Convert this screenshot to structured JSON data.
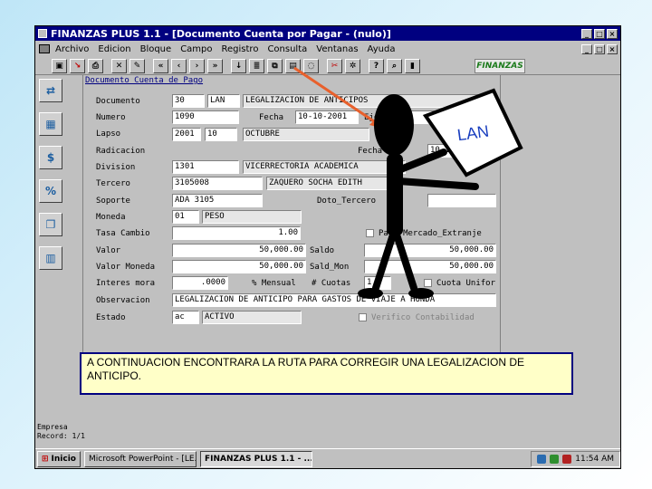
{
  "window": {
    "title": "FINANZAS PLUS 1.1 - [Documento Cuenta por Pagar - (nulo)]",
    "buttons": [
      "_",
      "□",
      "×"
    ]
  },
  "menu": {
    "items": [
      "Archivo",
      "Edicion",
      "Bloque",
      "Campo",
      "Registro",
      "Consulta",
      "Ventanas",
      "Ayuda"
    ],
    "mdi_buttons": [
      "_",
      "□",
      "×"
    ]
  },
  "toolbar": {
    "buttons": [
      "save",
      "exit",
      "print",
      "clear",
      "edit",
      "first",
      "prev",
      "next",
      "last",
      "insert",
      "list",
      "copy",
      "paste",
      "delete",
      "help",
      "query",
      "stop"
    ],
    "logo": "FINANZAS"
  },
  "form": {
    "title": "Documento Cuenta de Pago",
    "labels": {
      "documento": "Documento",
      "numero": "Numero",
      "lapso": "Lapso",
      "radicacion": "Radicacion",
      "division": "Division",
      "tercero": "Tercero",
      "soporte": "Soporte",
      "moneda": "Moneda",
      "tasa_cambio": "Tasa Cambio",
      "valor": "Valor",
      "valor_moneda": "Valor Moneda",
      "interes_mora": "Interes mora",
      "observacion": "Observacion",
      "estado": "Estado",
      "fecha": "Fecha",
      "ejec": "Ejec",
      "fecha2": "Fecha",
      "doto_tercero": "Doto_Tercero",
      "pago_extranj": "Pago Mercado_Extranje",
      "saldo": "Saldo",
      "sald_mon": "Sald_Mon",
      "mensual": "% Mensual",
      "cuotas": "# Cuotas",
      "cuota_unifor": "Cuota Unifor",
      "verifico": "Verifico Contabilidad"
    },
    "values": {
      "documento_code": "30",
      "documento_type": "LAN",
      "documento_desc": "LEGALIZACION DE ANTICIPOS",
      "numero": "1090",
      "fecha": "10-10-2001",
      "ejec": "",
      "lapso_year": "2001",
      "lapso_month": "10",
      "lapso_name": "OCTUBRE",
      "fecha_radicacion": "10-10-2001",
      "division_code": "1301",
      "division_name": "VICERRECTORIA ACADEMICA",
      "tercero_id": "3105008",
      "tercero_name": "ZAQUERO SOCHA EDITH",
      "soporte": "ADA 3105",
      "moneda_code": "01",
      "moneda_name": "PESO",
      "tasa_cambio": "1.00",
      "valor": "50,000.00",
      "saldo": "50,000.00",
      "valor_moneda": "50,000.00",
      "sald_mon": "50,000.00",
      "interes_mora": ".0000",
      "cuotas": "1",
      "observacion": "LEGALIZACION DE ANTICIPO PARA GASTOS DE VIAJE A HONDA",
      "estado_code": "ac",
      "estado_name": "ACTIVO"
    }
  },
  "sign_text": "LAN",
  "caption": "A CONTINUACION ENCONTRARA LA RUTA PARA CORREGIR UNA LEGALIZACION DE ANTICIPO.",
  "status": {
    "line1": "Empresa",
    "line2": "Record: 1/1"
  },
  "taskbar": {
    "start": "Inicio",
    "tasks": [
      "Microsoft PowerPoint - [LE...",
      "FINANZAS PLUS 1.1 - ..."
    ],
    "clock": "11:54 AM"
  }
}
